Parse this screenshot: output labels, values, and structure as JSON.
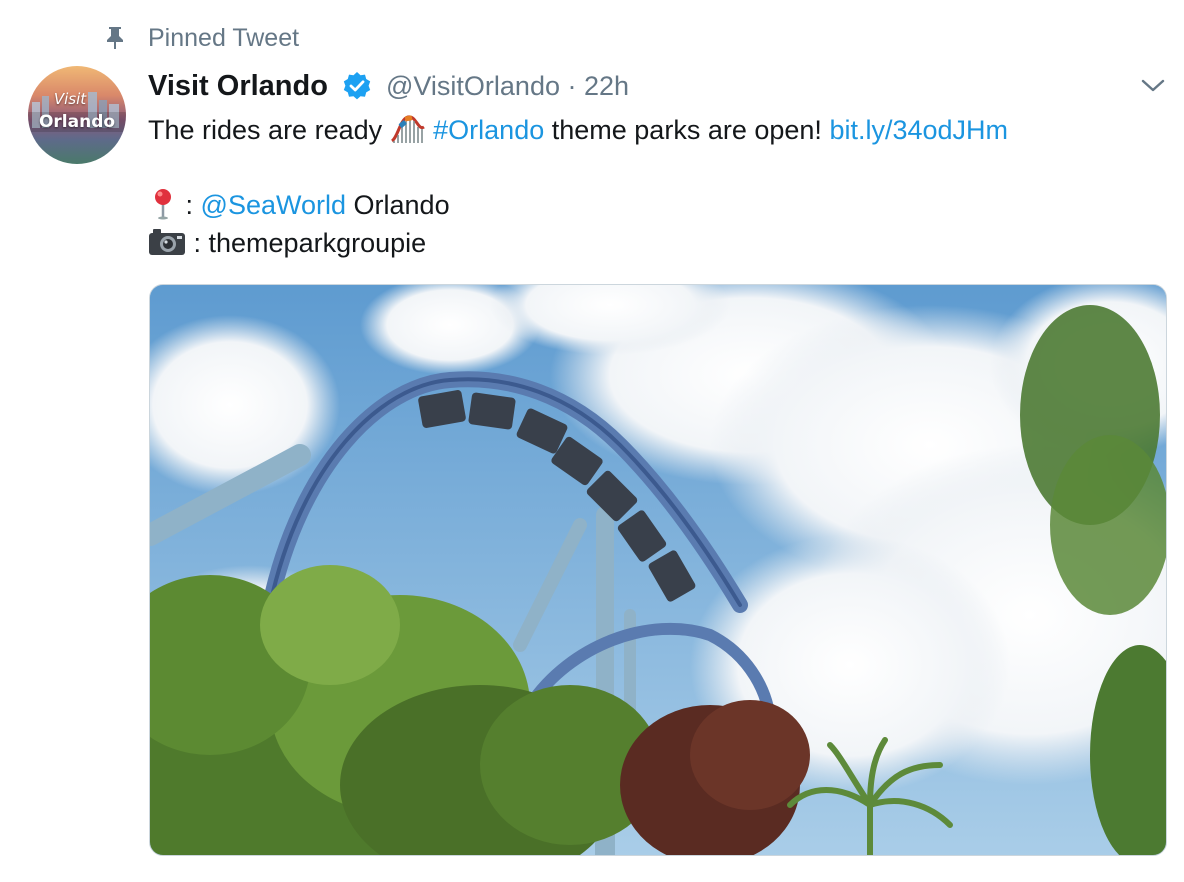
{
  "pinned": {
    "label": "Pinned Tweet",
    "icon": "pin-icon"
  },
  "author": {
    "display_name": "Visit Orlando",
    "verified": true,
    "handle": "@VisitOrlando",
    "separator": "·",
    "time": "22h",
    "avatar": {
      "visit_text": "Visit",
      "orlando_text": "Orlando"
    }
  },
  "tweet": {
    "line1": {
      "text_before": "The rides are ready",
      "emoji": "roller-coaster-emoji",
      "hashtag": "#Orlando",
      "text_mid": "theme parks are open!",
      "link": "bit.ly/34odJHm"
    },
    "line2": {
      "emoji": "round-pushpin-emoji",
      "prefix": ":",
      "mention": "@SeaWorld",
      "suffix": "Orlando"
    },
    "line3": {
      "emoji": "camera-emoji",
      "text": ": themeparkgroupie"
    }
  },
  "media": {
    "alt_description_icon": "roller-coaster-photo"
  },
  "colors": {
    "link": "#1b95e0",
    "muted": "#657786",
    "text": "#14171a",
    "verified": "#1da1f2"
  }
}
